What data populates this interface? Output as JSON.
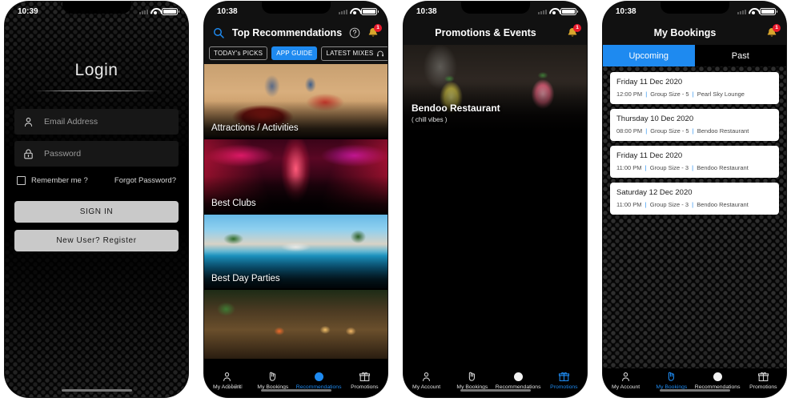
{
  "screens": [
    {
      "id": "login",
      "status_bar": {
        "time": "10:39",
        "wifi_icon": "wifi-icon",
        "battery_icon": "battery-icon",
        "signal_icon": "signal-icon"
      },
      "title": "Login",
      "fields": [
        {
          "icon": "user-icon",
          "placeholder": "Email Address"
        },
        {
          "icon": "lock-icon",
          "placeholder": "Password"
        }
      ],
      "remember_label": "Remember me ?",
      "forgot_label": "Forgot Password?",
      "primary_button": "SIGN IN",
      "secondary_button": "New User? Register"
    },
    {
      "id": "recommendations",
      "status_bar": {
        "time": "10:38"
      },
      "appbar": {
        "search_icon": "search-icon",
        "title": "Top Recommendations",
        "help_icon": "help-circle-icon",
        "bell_icon": "bell-icon",
        "badge": "1"
      },
      "chips": [
        {
          "label": "TODAY's PICKS",
          "active": false,
          "icon": ""
        },
        {
          "label": "APP GUIDE",
          "active": true,
          "icon": ""
        },
        {
          "label": "LATEST MIXES",
          "active": false,
          "icon": "headphones-icon"
        }
      ],
      "cards": [
        {
          "label": "Attractions / Activities",
          "art": "img-atv"
        },
        {
          "label": "Best Clubs",
          "art": "img-club"
        },
        {
          "label": "Best Day Parties",
          "art": "img-pool"
        },
        {
          "label": "",
          "art": "img-resort"
        }
      ],
      "watermark": "stau",
      "tabbar": {
        "active": "Recommendations",
        "items": [
          {
            "label": "My Account",
            "icon": "person-icon"
          },
          {
            "label": "My Bookings",
            "icon": "booking-hand-icon"
          },
          {
            "label": "Recommendations",
            "icon": "circle-dot-icon"
          },
          {
            "label": "Promotions",
            "icon": "gift-icon"
          }
        ]
      }
    },
    {
      "id": "promotions",
      "status_bar": {
        "time": "10:38"
      },
      "appbar": {
        "title": "Promotions & Events",
        "bell_icon": "bell-icon",
        "badge": "1"
      },
      "hero": {
        "title": "Bendoo Restaurant",
        "subtitle": "( chill vibes )",
        "art": "img-bendoo"
      },
      "tabbar": {
        "active": "Promotions",
        "items": [
          {
            "label": "My Account",
            "icon": "person-icon"
          },
          {
            "label": "My Bookings",
            "icon": "booking-hand-icon"
          },
          {
            "label": "Recommendations",
            "icon": "circle-dot-icon"
          },
          {
            "label": "Promotions",
            "icon": "gift-icon"
          }
        ]
      }
    },
    {
      "id": "bookings",
      "status_bar": {
        "time": "10:38"
      },
      "appbar": {
        "title": "My Bookings",
        "bell_icon": "bell-icon",
        "badge": "1"
      },
      "segments": [
        {
          "label": "Upcoming",
          "active": true
        },
        {
          "label": "Past",
          "active": false
        }
      ],
      "bookings": [
        {
          "date": "Friday 11 Dec 2020",
          "time": "12:00 PM",
          "group": "Group Size - 5",
          "venue": "Pearl Sky Lounge"
        },
        {
          "date": "Thursday 10 Dec 2020",
          "time": "08:00 PM",
          "group": "Group Size - 5",
          "venue": "Bendoo Restaurant"
        },
        {
          "date": "Friday 11 Dec 2020",
          "time": "11:00 PM",
          "group": "Group Size - 3",
          "venue": "Bendoo Restaurant"
        },
        {
          "date": "Saturday 12 Dec 2020",
          "time": "11:00 PM",
          "group": "Group Size - 3",
          "venue": "Bendoo Restaurant"
        }
      ],
      "tabbar": {
        "active": "My Bookings",
        "items": [
          {
            "label": "My Account",
            "icon": "person-icon"
          },
          {
            "label": "My Bookings",
            "icon": "booking-hand-icon"
          },
          {
            "label": "Recommendations",
            "icon": "circle-dot-icon"
          },
          {
            "label": "Promotions",
            "icon": "gift-icon"
          }
        ]
      }
    }
  ],
  "colors": {
    "accent_blue": "#1e8af0",
    "badge_red": "#e8192c",
    "button_grey": "#c9c9c9",
    "screen_black": "#000000"
  }
}
